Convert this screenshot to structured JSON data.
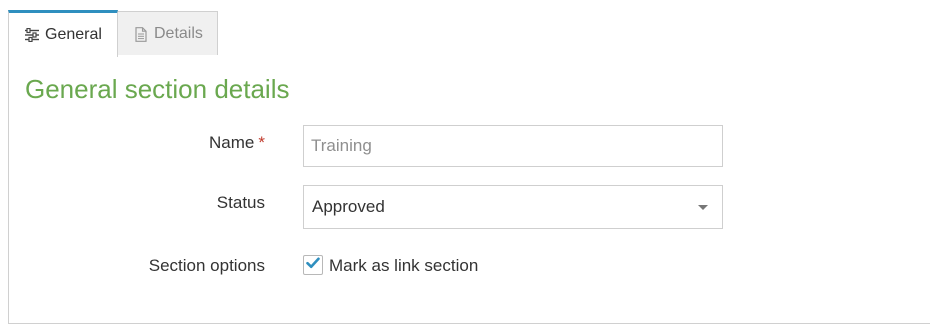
{
  "tabs": [
    {
      "label": "General",
      "icon": "sliders-icon",
      "active": true
    },
    {
      "label": "Details",
      "icon": "document-icon",
      "active": false
    }
  ],
  "section": {
    "title": "General section details"
  },
  "form": {
    "name": {
      "label": "Name",
      "required_mark": "*",
      "placeholder": "Training",
      "value": ""
    },
    "status": {
      "label": "Status",
      "selected": "Approved"
    },
    "section_options": {
      "label": "Section options",
      "checkbox_label": "Mark as link section",
      "checked": true
    }
  },
  "colors": {
    "accent": "#2f8fbf",
    "title": "#6aa84f",
    "required": "#c0392b"
  }
}
